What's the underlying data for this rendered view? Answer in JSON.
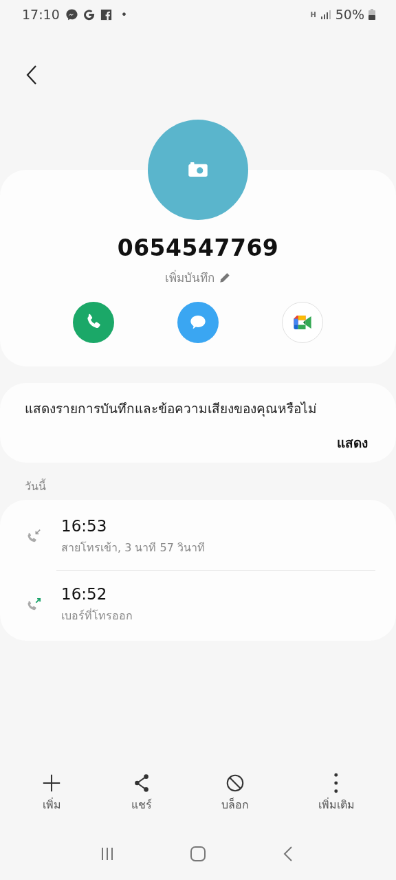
{
  "status_bar": {
    "time": "17:10",
    "notification_dot": "•",
    "network": "H",
    "battery": "50%"
  },
  "contact": {
    "number": "0654547769",
    "add_note": "เพิ่มบันทึก"
  },
  "voicemail_prompt": {
    "text": "แสดงรายการบันทึกและข้อความเสียงของคุณหรือไม่",
    "action": "แสดง"
  },
  "history": {
    "section": "วันนี้",
    "calls": [
      {
        "kind": "incoming",
        "time": "16:53",
        "detail": "สายโทรเข้า, 3 นาที 57 วินาที"
      },
      {
        "kind": "outgoing",
        "time": "16:52",
        "detail": "เบอร์ที่โทรออก"
      }
    ]
  },
  "bottom_actions": [
    {
      "kind": "add",
      "label": "เพิ่ม"
    },
    {
      "kind": "share",
      "label": "แชร์"
    },
    {
      "kind": "block",
      "label": "บล็อก"
    },
    {
      "kind": "more",
      "label": "เพิ่มเติม"
    }
  ]
}
